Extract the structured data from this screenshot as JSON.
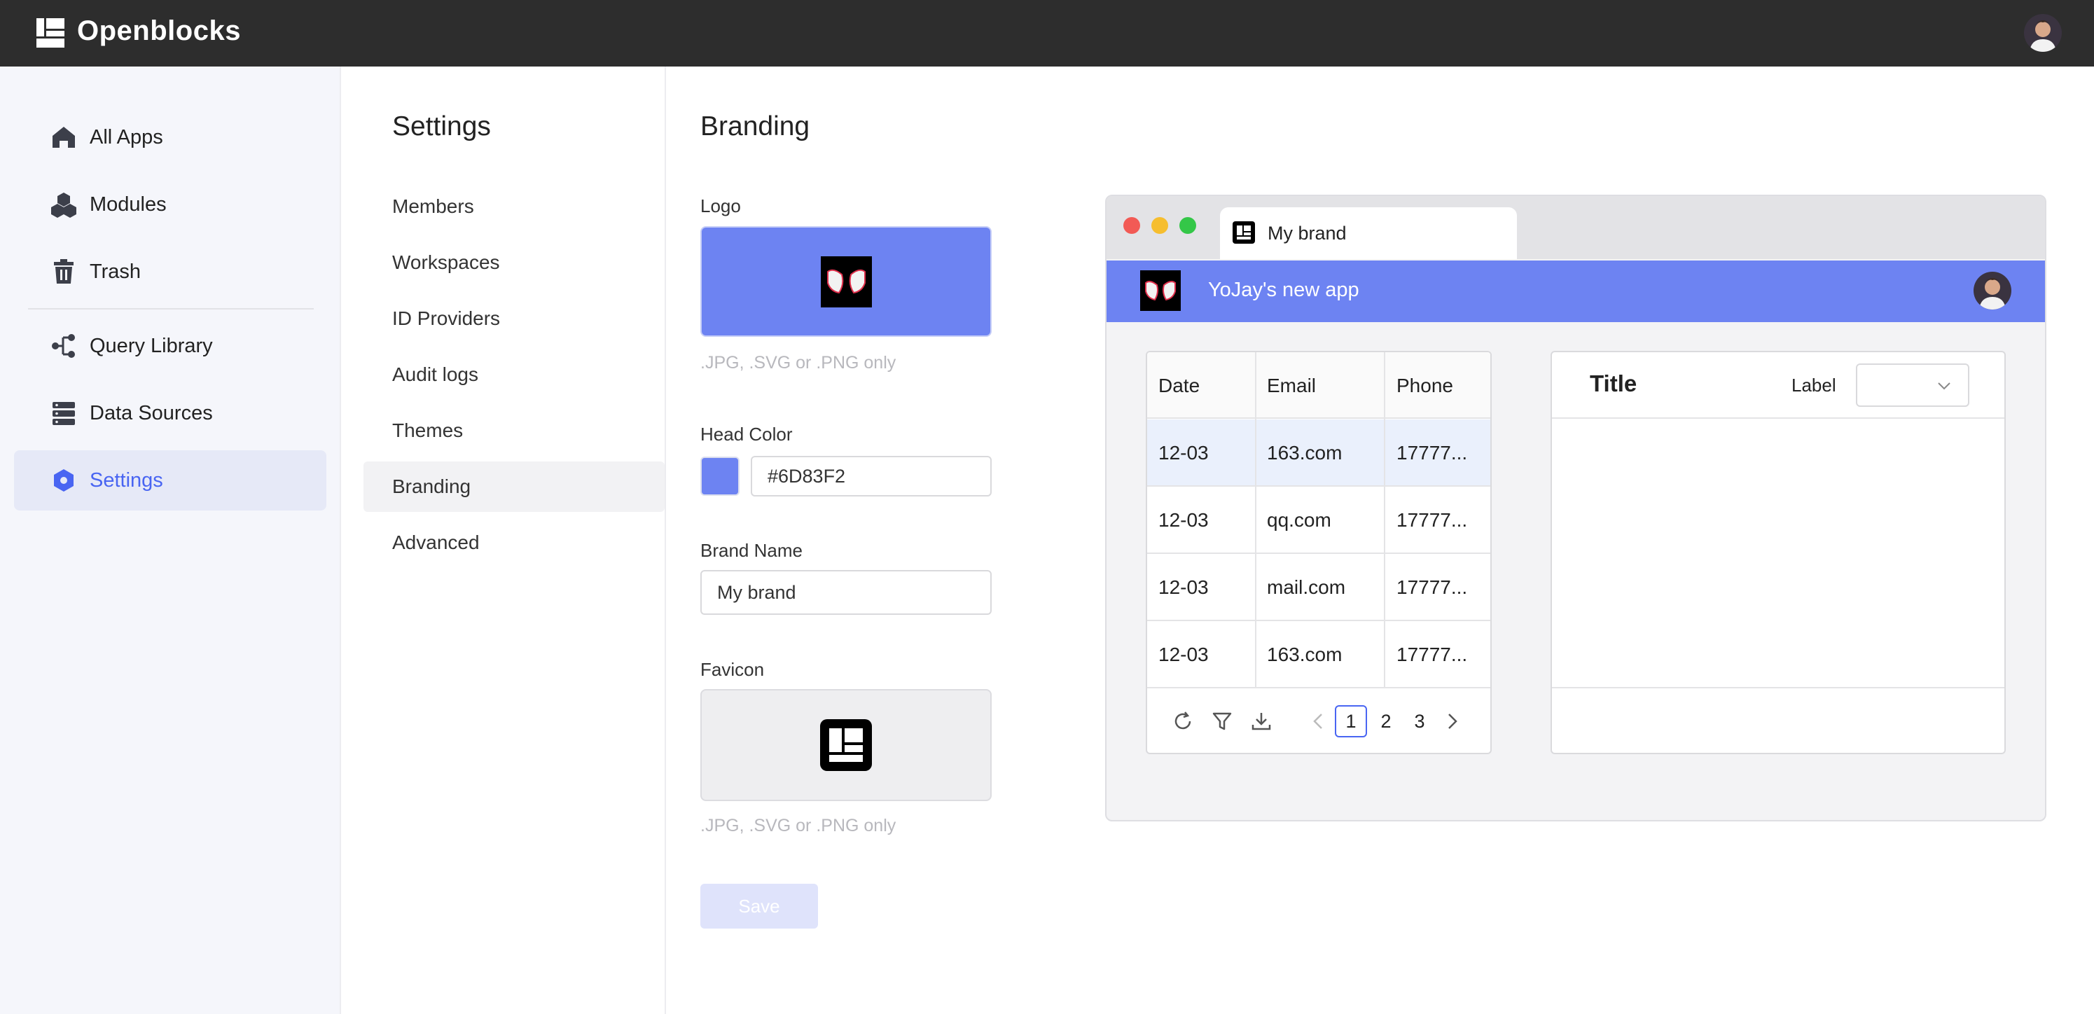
{
  "header": {
    "app_name": "Openblocks"
  },
  "sidebar": {
    "items": [
      {
        "label": "All Apps",
        "icon": "home-icon"
      },
      {
        "label": "Modules",
        "icon": "modules-icon"
      },
      {
        "label": "Trash",
        "icon": "trash-icon"
      },
      {
        "label": "Query Library",
        "icon": "query-library-icon"
      },
      {
        "label": "Data Sources",
        "icon": "data-sources-icon"
      },
      {
        "label": "Settings",
        "icon": "settings-icon",
        "active": true
      }
    ]
  },
  "settings_menu": {
    "title": "Settings",
    "items": [
      "Members",
      "Workspaces",
      "ID Providers",
      "Audit logs",
      "Themes",
      "Branding",
      "Advanced"
    ],
    "active": "Branding"
  },
  "branding": {
    "title": "Branding",
    "logo_label": "Logo",
    "logo_hint": ".JPG, .SVG or .PNG only",
    "head_color_label": "Head Color",
    "head_color_value": "#6D83F2",
    "brand_name_label": "Brand Name",
    "brand_name_value": "My brand",
    "favicon_label": "Favicon",
    "favicon_hint": ".JPG, .SVG or .PNG only",
    "save_label": "Save"
  },
  "preview": {
    "tab_title": "My brand",
    "app_title": "YoJay's new app",
    "head_color": "#6D83F2",
    "table": {
      "columns": [
        "Date",
        "Email",
        "Phone"
      ],
      "rows": [
        [
          "12-03",
          "163.com",
          "17777..."
        ],
        [
          "12-03",
          "qq.com",
          "17777..."
        ],
        [
          "12-03",
          "mail.com",
          "17777..."
        ],
        [
          "12-03",
          "163.com",
          "17777..."
        ]
      ],
      "pages": [
        "1",
        "2",
        "3"
      ],
      "current_page": "1"
    },
    "form": {
      "title": "Title",
      "label": "Label"
    }
  },
  "colors": {
    "accent": "#4965F2",
    "topbar": "#2D2D2D",
    "head_color": "#6D83F2"
  }
}
